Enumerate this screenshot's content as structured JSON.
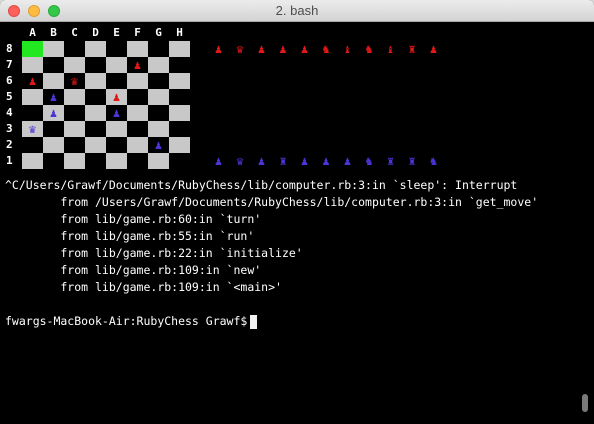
{
  "window": {
    "title": "2. bash"
  },
  "board": {
    "files": [
      "A",
      "B",
      "C",
      "D",
      "E",
      "F",
      "G",
      "H"
    ],
    "ranks": [
      "8",
      "7",
      "6",
      "5",
      "4",
      "3",
      "2",
      "1"
    ],
    "rows": [
      [
        "",
        "",
        "",
        "",
        "",
        "",
        "",
        ""
      ],
      [
        "",
        "",
        "",
        "",
        "",
        "♟",
        "",
        ""
      ],
      [
        "♟",
        "",
        "♛",
        "",
        "",
        "",
        "",
        ""
      ],
      [
        "",
        "♟",
        "",
        "",
        "♟",
        "",
        "",
        ""
      ],
      [
        "",
        "♟",
        "",
        "",
        "♟",
        "",
        "",
        ""
      ],
      [
        "♛",
        "",
        "",
        "",
        "",
        "",
        "",
        ""
      ],
      [
        "",
        "",
        "",
        "",
        "",
        "",
        "♟",
        ""
      ],
      [
        "",
        "",
        "",
        "",
        "",
        "",
        "",
        ""
      ]
    ],
    "colors": [
      [
        "",
        "",
        "",
        "",
        "",
        "",
        "",
        ""
      ],
      [
        "",
        "",
        "",
        "",
        "",
        "red",
        "",
        ""
      ],
      [
        "red",
        "",
        "red",
        "",
        "",
        "",
        "",
        ""
      ],
      [
        "",
        "blue",
        "",
        "",
        "red",
        "",
        "",
        ""
      ],
      [
        "",
        "blue",
        "",
        "",
        "blue",
        "",
        "",
        ""
      ],
      [
        "blue",
        "",
        "",
        "",
        "",
        "",
        "",
        ""
      ],
      [
        "",
        "",
        "",
        "",
        "",
        "",
        "blue",
        ""
      ],
      [
        "",
        "",
        "",
        "",
        "",
        "",
        "",
        ""
      ]
    ],
    "highlight": "A8",
    "captured_red": [
      "♟",
      "♛",
      "♟",
      "♟",
      "♟",
      "♞",
      "♝",
      "♞",
      "♝",
      "♜",
      "♟"
    ],
    "captured_blue": [
      "♟",
      "♛",
      "♟",
      "♜",
      "♟",
      "♟",
      "♟",
      "♞",
      "♜",
      "♜",
      "♞"
    ]
  },
  "output": [
    "^C/Users/Grawf/Documents/RubyChess/lib/computer.rb:3:in `sleep': Interrupt",
    "        from /Users/Grawf/Documents/RubyChess/lib/computer.rb:3:in `get_move'",
    "        from lib/game.rb:60:in `turn'",
    "        from lib/game.rb:55:in `run'",
    "        from lib/game.rb:22:in `initialize'",
    "        from lib/game.rb:109:in `new'",
    "        from lib/game.rb:109:in `<main>'",
    "",
    "fwargs-MacBook-Air:RubyChess Grawf$ "
  ],
  "colors": {
    "piece_red": "#e01818",
    "piece_blue": "#4a36d8",
    "highlight": "#22e822"
  }
}
